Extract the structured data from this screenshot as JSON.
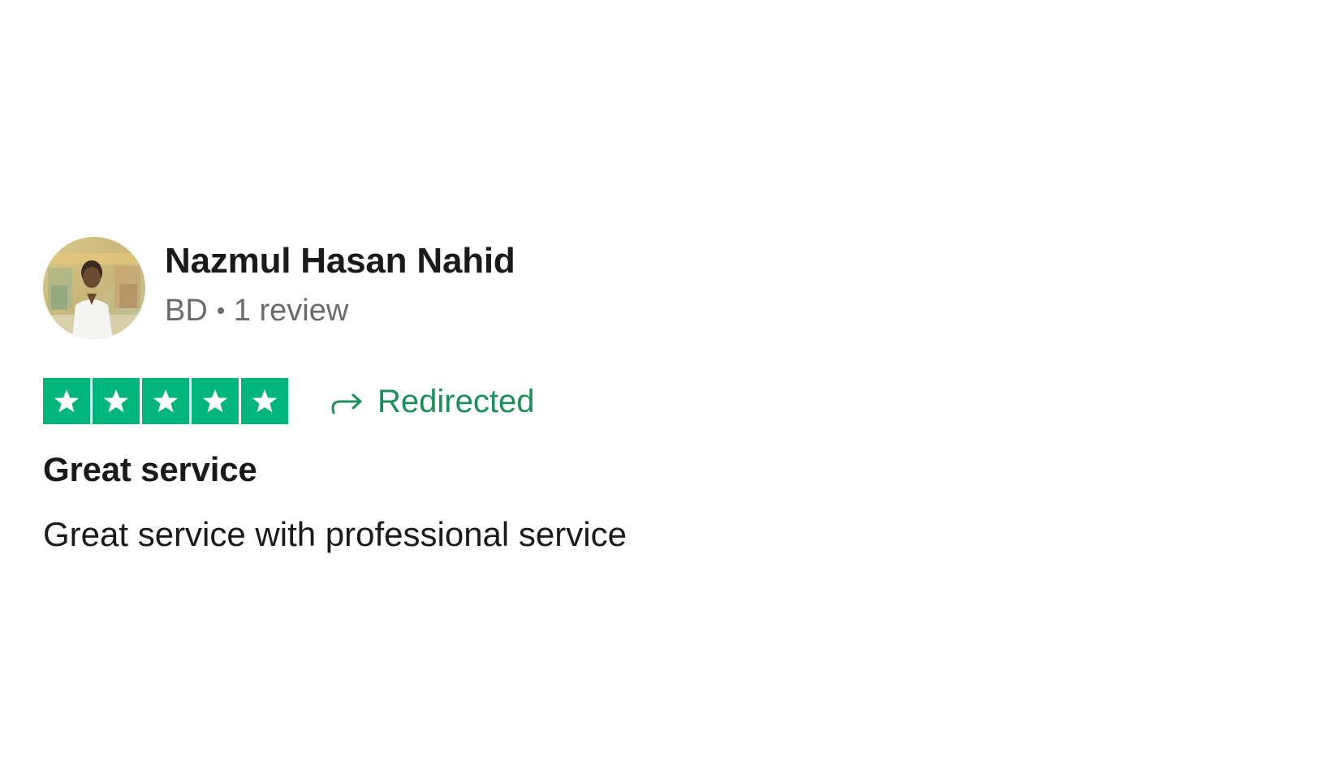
{
  "reviewer": {
    "name": "Nazmul Hasan Nahid",
    "country": "BD",
    "review_count": "1 review"
  },
  "rating": {
    "stars": 5,
    "max": 5,
    "star_color": "#00b67a",
    "status_label": "Redirected",
    "status_color": "#1a8f5b",
    "status_icon": "redirect-arrow-icon"
  },
  "review": {
    "title": "Great service",
    "body": "Great service with professional service"
  }
}
